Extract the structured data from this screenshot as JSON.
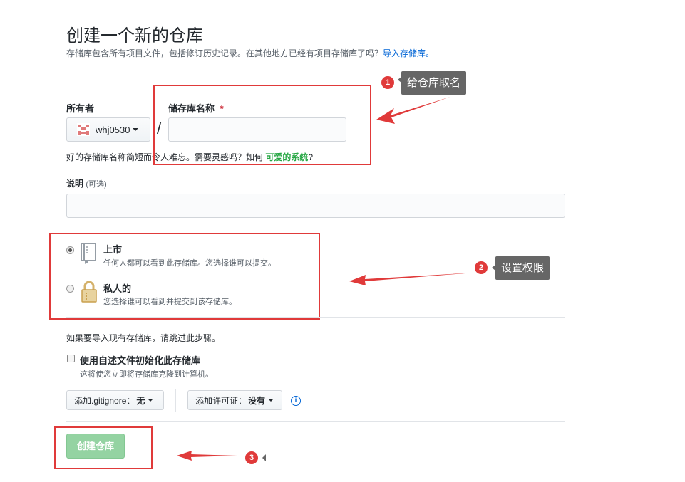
{
  "header": {
    "title": "创建一个新的仓库",
    "subtitle": "存储库包含所有项目文件，包括修订历史记录。在其他地方已经有项目存储库了吗？",
    "import_link": "导入存储库。"
  },
  "owner": {
    "label": "所有者",
    "value": "whj0530"
  },
  "repo_name": {
    "label": "储存库名称",
    "required_mark": "*",
    "slash": "/",
    "value": "",
    "hint_prefix": "好的存储库名称简短而令人难忘。需要灵感吗？如何 ",
    "hint_suggestion": "可爱的系统",
    "hint_suffix": "?"
  },
  "description": {
    "label": "说明",
    "optional": "(可选)",
    "value": ""
  },
  "visibility": {
    "options": [
      {
        "title": "上市",
        "desc": "任何人都可以看到此存储库。您选择谁可以提交。",
        "checked": true
      },
      {
        "title": "私人的",
        "desc": "您选择谁可以看到并提交到该存储库。",
        "checked": false
      }
    ]
  },
  "import_note": "如果要导入现有存储库，请跳过此步骤。",
  "init_readme": {
    "label": "使用自述文件初始化此存储库",
    "desc": "这将使您立即将存储库克隆到计算机。",
    "checked": false
  },
  "gitignore": {
    "label": "添加.gitignore：",
    "value": "无"
  },
  "license": {
    "label": "添加许可证：",
    "value": "没有"
  },
  "info_icon": "i",
  "submit_label": "创建仓库",
  "annotations": [
    {
      "number": "1",
      "text": "给仓库取名"
    },
    {
      "number": "2",
      "text": "设置权限"
    },
    {
      "number": "3",
      "text": ""
    }
  ],
  "colors": {
    "accent_red": "#e03a3a",
    "link_blue": "#0366d6",
    "suggestion_green": "#28a745",
    "button_green_disabled": "#94d3a2"
  }
}
